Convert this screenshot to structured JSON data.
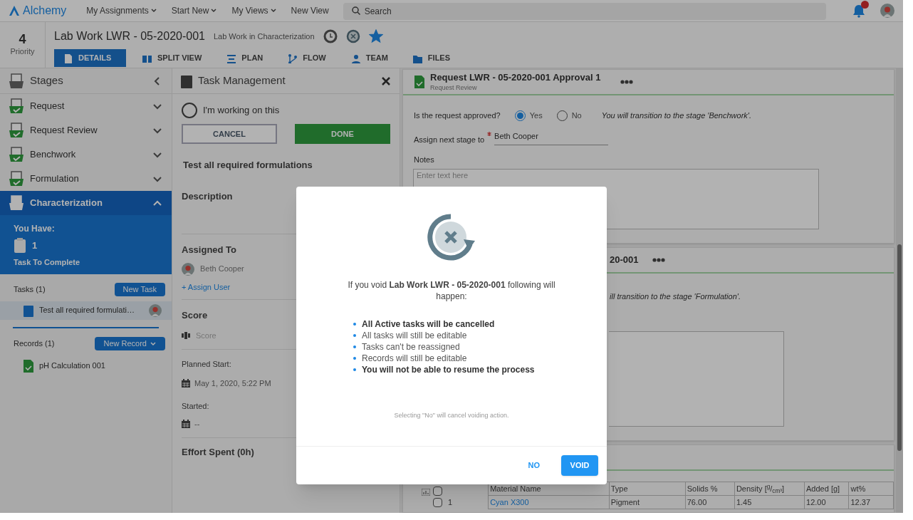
{
  "topbar": {
    "logo": "Alchemy",
    "menus": [
      {
        "label": "My Assignments",
        "dropdown": true
      },
      {
        "label": "Start New",
        "dropdown": true
      },
      {
        "label": "My Views",
        "dropdown": true
      },
      {
        "label": "New View",
        "dropdown": false
      }
    ],
    "search": {
      "placeholder": "Search"
    },
    "notifications": {
      "unread": true
    }
  },
  "record": {
    "priority": "4",
    "priority_label": "Priority",
    "title": "Lab Work LWR - 05-2020-001",
    "status": "Lab Work in Characterization",
    "starred": true
  },
  "tabs": [
    {
      "label": "DETAILS",
      "selected": true
    },
    {
      "label": "SPLIT VIEW",
      "selected": false
    },
    {
      "label": "PLAN",
      "selected": false
    },
    {
      "label": "FLOW",
      "selected": false
    },
    {
      "label": "TEAM",
      "selected": false
    },
    {
      "label": "FILES",
      "selected": false
    }
  ],
  "stages": {
    "title": "Stages",
    "items": [
      {
        "label": "Request",
        "expanded": false,
        "selected": false
      },
      {
        "label": "Request Review",
        "expanded": false,
        "selected": false
      },
      {
        "label": "Benchwork",
        "expanded": false,
        "selected": false
      },
      {
        "label": "Formulation",
        "expanded": false,
        "selected": false
      },
      {
        "label": "Characterization",
        "expanded": true,
        "selected": true
      }
    ],
    "summary": {
      "heading": "You Have:",
      "count": "1",
      "caption": "Task To Complete"
    },
    "tasks": {
      "label": "Tasks (1)",
      "button": "New Task",
      "items": [
        {
          "label": "Test all required formulati…",
          "selected": true
        }
      ]
    },
    "records": {
      "label": "Records (1)",
      "button": "New Record",
      "items": [
        {
          "label": "pH Calculation 001"
        }
      ]
    }
  },
  "task_panel": {
    "title": "Task Management",
    "working": {
      "label": "I'm working on this",
      "checked": false
    },
    "cancel": "CANCEL",
    "done": "DONE",
    "task_name": "Test all required formulations",
    "description_label": "Description",
    "assigned_label": "Assigned To",
    "assignee": "Beth Cooper",
    "assign_link": "+ Assign User",
    "score_label": "Score",
    "score_placeholder": "Score",
    "planned_start_label": "Planned Start:",
    "planned_start": "May 1, 2020, 5:22 PM",
    "started_label": "Started:",
    "started": "--",
    "effort": "Effort Spent (0h)"
  },
  "cards": [
    {
      "kind": "approval",
      "title": "Request LWR - 05-2020-001 Approval 1",
      "subtitle": "Request Review",
      "question": "Is the request approved?",
      "options": [
        {
          "label": "Yes",
          "selected": true
        },
        {
          "label": "No",
          "selected": false
        }
      ],
      "transition": "You will transition to the stage 'Benchwork'.",
      "assign_label": "Assign next stage to",
      "assign_required": true,
      "assignee": "Beth Cooper",
      "notes_label": "Notes",
      "notes_placeholder": "Enter text here"
    },
    {
      "kind": "partial",
      "title": "20-001",
      "transition": "ill transition to the stage 'Formulation'."
    },
    {
      "kind": "table",
      "select_all_checked": false,
      "columns": [
        "Material Name",
        "Type",
        "Solids %",
        "Density [$^{g}$/$_{cm³}$]",
        "Added [g]",
        "wt%"
      ],
      "rows": [
        {
          "number": "1",
          "checked": false,
          "cells": [
            "Cyan X300",
            "Pigment",
            "76.00",
            "1.45",
            "12.00",
            "12.37"
          ]
        }
      ]
    }
  ],
  "dialog": {
    "message": "If you void **Lab Work LWR - 05-2020-001** following will happen:",
    "points": [
      {
        "text": "All Active tasks will be cancelled",
        "bold": true
      },
      {
        "text": "All tasks will still be editable",
        "bold": false
      },
      {
        "text": "Tasks can't be reassigned",
        "bold": false
      },
      {
        "text": "Records will still be editable",
        "bold": false
      },
      {
        "text": "You will not be able to resume the process",
        "bold": true
      }
    ],
    "note": "Selecting \"No\" will cancel voiding action.",
    "buttons": [
      {
        "label": "NO",
        "kind": "text"
      },
      {
        "label": "VOID",
        "kind": "primary"
      }
    ]
  }
}
